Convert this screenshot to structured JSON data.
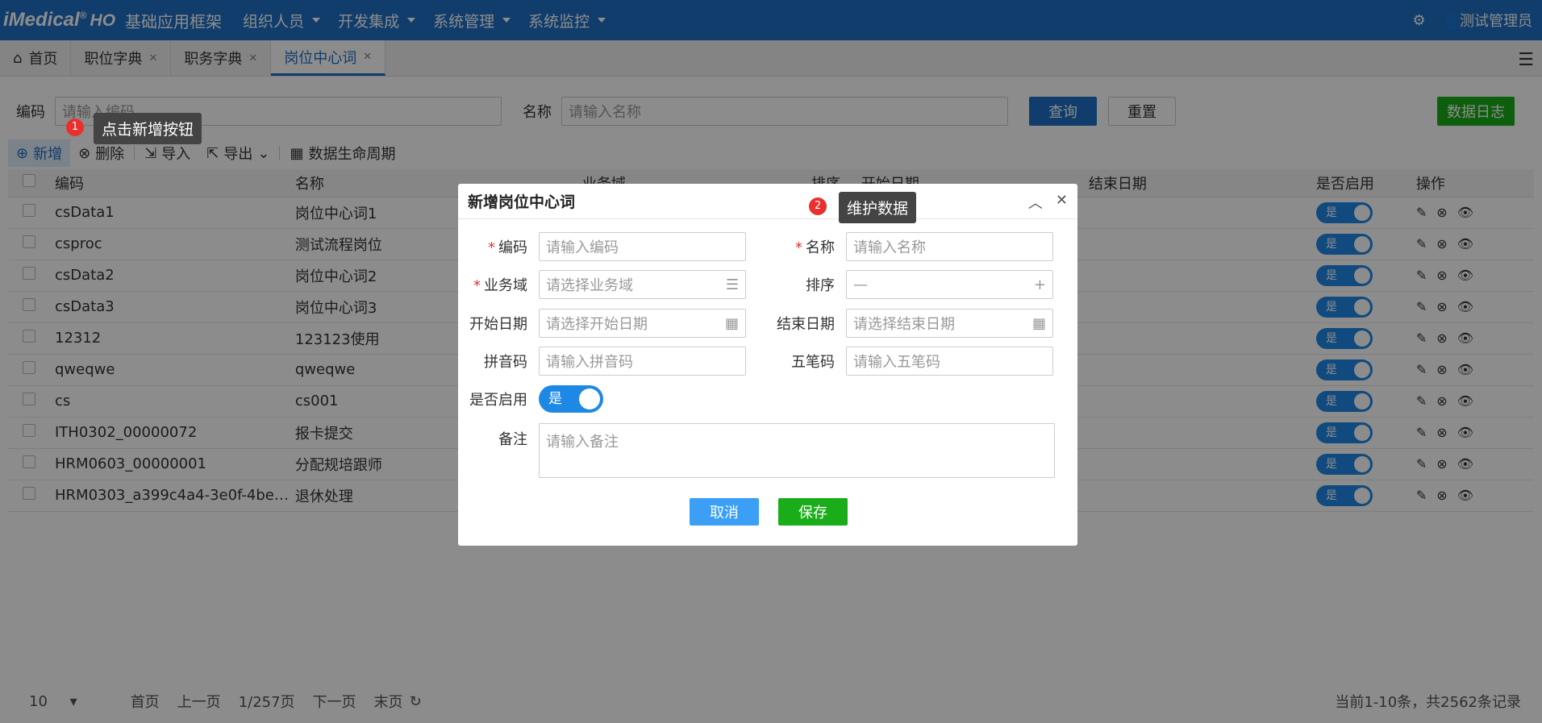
{
  "header": {
    "logo": "iMedical",
    "logo_suffix": "HO",
    "app_name": "基础应用框架",
    "menus": [
      "组织人员",
      "开发集成",
      "系统管理",
      "系统监控"
    ],
    "user": "测试管理员"
  },
  "tabs": [
    {
      "label": "首页"
    },
    {
      "label": "职位字典"
    },
    {
      "label": "职务字典"
    },
    {
      "label": "岗位中心词"
    }
  ],
  "search": {
    "code_label": "编码",
    "code_placeholder": "请输入编码",
    "name_label": "名称",
    "name_placeholder": "请输入名称",
    "query_btn": "查询",
    "reset_btn": "重置",
    "log_btn": "数据日志"
  },
  "toolbar": {
    "add": "新增",
    "delete": "删除",
    "import": "导入",
    "export": "导出",
    "lifecycle": "数据生命周期"
  },
  "table": {
    "columns": [
      "编码",
      "名称",
      "业务域",
      "排序",
      "开始日期",
      "结束日期",
      "是否启用",
      "操作"
    ],
    "rows": [
      {
        "code": "csData1",
        "name": "岗位中心词1"
      },
      {
        "code": "csproc",
        "name": "测试流程岗位"
      },
      {
        "code": "csData2",
        "name": "岗位中心词2"
      },
      {
        "code": "csData3",
        "name": "岗位中心词3"
      },
      {
        "code": "12312",
        "name": "123123使用"
      },
      {
        "code": "qweqwe",
        "name": "qweqwe"
      },
      {
        "code": "cs",
        "name": "cs001"
      },
      {
        "code": "ITH0302_00000072",
        "name": "报卡提交"
      },
      {
        "code": "HRM0603_00000001",
        "name": "分配规培跟师"
      },
      {
        "code": "HRM0303_a399c4a4-3e0f-4be…",
        "name": "退休处理"
      }
    ],
    "toggle_label": "是"
  },
  "pager": {
    "page_size": "10",
    "first": "首页",
    "prev": "上一页",
    "page_info": "1/257页",
    "next": "下一页",
    "last": "末页",
    "summary": "当前1-10条，共2562条记录"
  },
  "tips": {
    "tip1_num": "1",
    "tip1": "点击新增按钮",
    "tip2_num": "2",
    "tip2": "维护数据"
  },
  "dialog": {
    "title": "新增岗位中心词",
    "code_label": "编码",
    "code_placeholder": "请输入编码",
    "name_label": "名称",
    "name_placeholder": "请输入名称",
    "domain_label": "业务域",
    "domain_placeholder": "请选择业务域",
    "sort_label": "排序",
    "start_label": "开始日期",
    "start_placeholder": "请选择开始日期",
    "end_label": "结束日期",
    "end_placeholder": "请选择结束日期",
    "pinyin_label": "拼音码",
    "pinyin_placeholder": "请输入拼音码",
    "wubi_label": "五笔码",
    "wubi_placeholder": "请输入五笔码",
    "enabled_label": "是否启用",
    "enabled_value": "是",
    "remark_label": "备注",
    "remark_placeholder": "请输入备注",
    "cancel": "取消",
    "save": "保存"
  },
  "colors": {
    "primary": "#1e6fc4",
    "success": "#1aad19",
    "danger": "#e8312f"
  }
}
